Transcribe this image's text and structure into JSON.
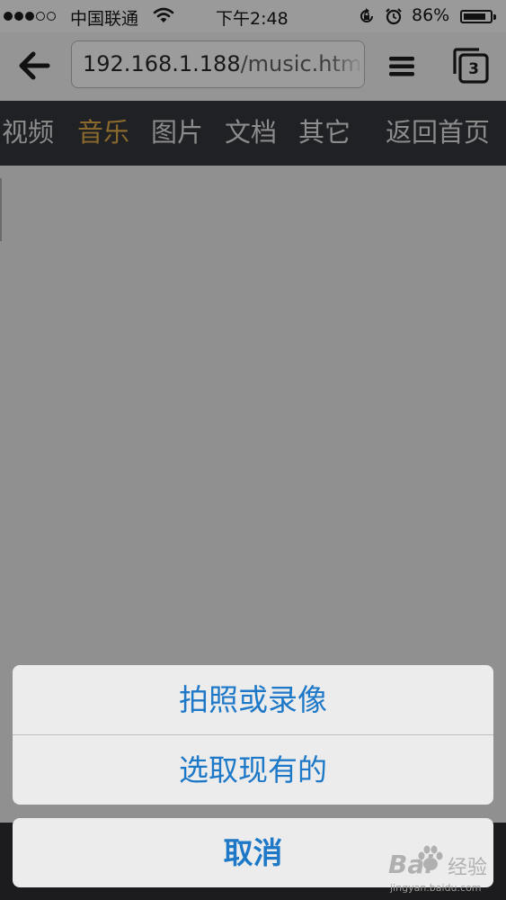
{
  "status_bar": {
    "carrier": "中国联通",
    "time": "下午2:48",
    "battery_percent": "86%",
    "battery_level": 0.86,
    "signal_bars_filled": 3,
    "signal_bars_total": 5,
    "icons": [
      "wifi-icon",
      "rotation-lock-icon",
      "alarm-icon",
      "battery-icon"
    ]
  },
  "browser": {
    "url_host": "192.168.1.188",
    "url_path": "/music.htm",
    "tab_count": "3",
    "icons": [
      "back-arrow-icon",
      "menu-icon",
      "tabs-icon"
    ]
  },
  "nav": {
    "items": [
      {
        "label": "视频",
        "active": false
      },
      {
        "label": "音乐",
        "active": true
      },
      {
        "label": "图片",
        "active": false
      },
      {
        "label": "文档",
        "active": false
      },
      {
        "label": "其它",
        "active": false
      }
    ],
    "home_label": "返回首页",
    "active_color": "#8a6a2c",
    "inactive_color": "#8c8c8c"
  },
  "action_sheet": {
    "option1": "拍照或录像",
    "option2": "选取现有的",
    "cancel": "取消",
    "button_color": "#1d78c8"
  },
  "watermark": {
    "logo": "Bai",
    "suffix": "经验",
    "url": "jingyan.baidu.com"
  }
}
